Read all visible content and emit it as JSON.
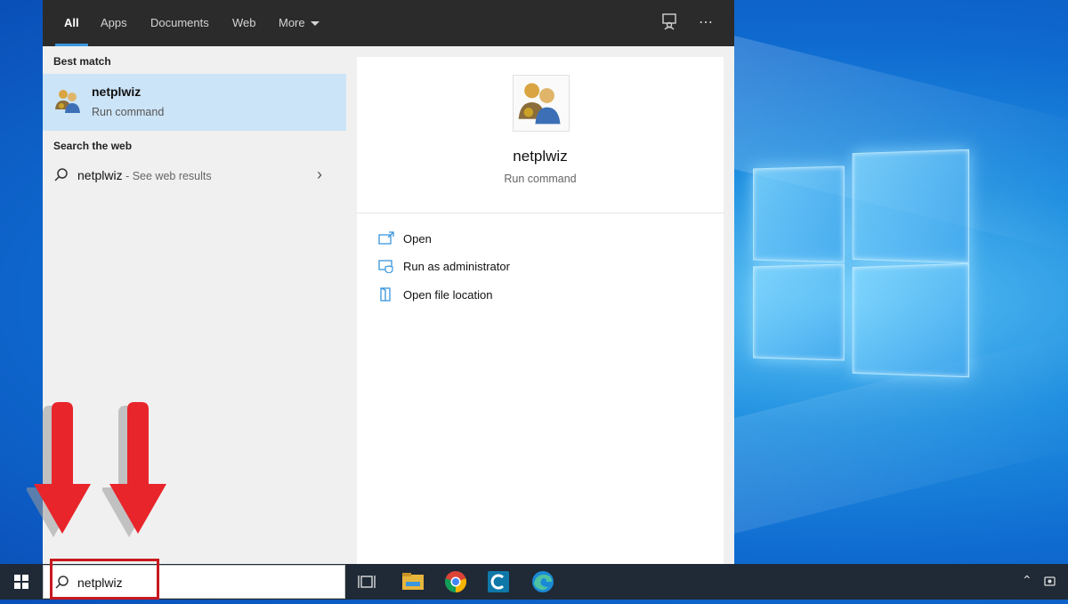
{
  "search": {
    "tabs": [
      {
        "label": "All"
      },
      {
        "label": "Apps"
      },
      {
        "label": "Documents"
      },
      {
        "label": "Web"
      },
      {
        "label": "More"
      }
    ],
    "best_match_header": "Best match",
    "best_match": {
      "title": "netplwiz",
      "subtitle": "Run command"
    },
    "search_web_header": "Search the web",
    "web_result": {
      "query": "netplwiz",
      "suffix": " - See web results"
    },
    "detail": {
      "title": "netplwiz",
      "subtitle": "Run command",
      "actions": [
        {
          "label": "Open",
          "icon": "open-window-icon"
        },
        {
          "label": "Run as administrator",
          "icon": "shield-window-icon"
        },
        {
          "label": "Open file location",
          "icon": "file-location-icon"
        }
      ]
    },
    "query_value": "netplwiz"
  },
  "taskbar": {
    "pinned": [
      "task-view-icon",
      "file-explorer-icon",
      "chrome-icon",
      "app-icon",
      "edge-icon"
    ]
  },
  "colors": {
    "accent": "#3a96dd",
    "highlight_border": "#c8181e",
    "arrow": "#e8252b",
    "selected_row": "#cce4f7"
  }
}
